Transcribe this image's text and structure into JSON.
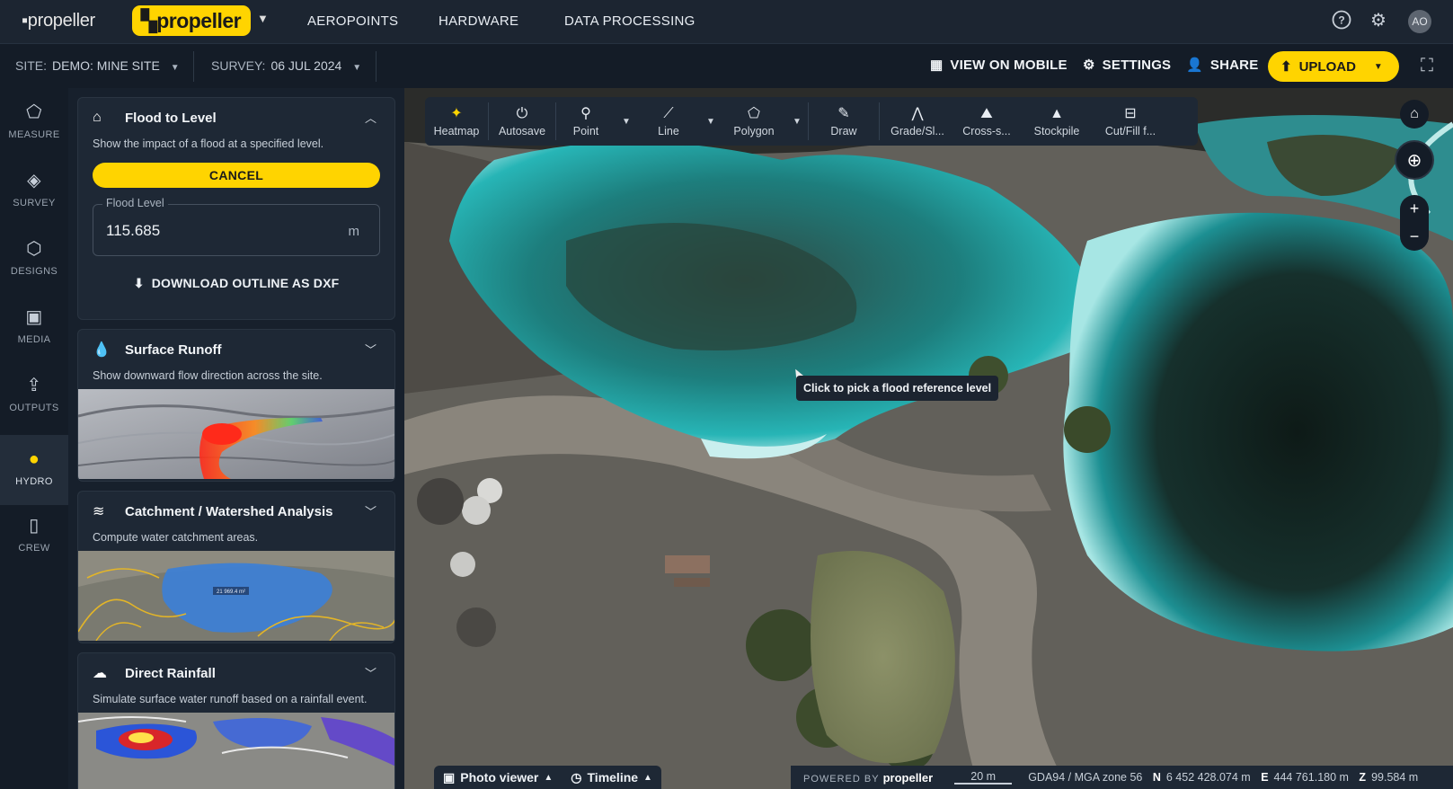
{
  "topbar": {
    "brand_small": "propeller",
    "brand_big": "propeller",
    "nav": [
      "AEROPOINTS",
      "HARDWARE",
      "DATA PROCESSING"
    ],
    "avatar": "AO"
  },
  "subbar": {
    "site_label": "SITE:",
    "site_value": "DEMO: MINE SITE",
    "survey_label": "SURVEY:",
    "survey_value": "06 JUL 2024",
    "view_mobile": "VIEW ON MOBILE",
    "settings": "SETTINGS",
    "share": "SHARE",
    "upload": "UPLOAD"
  },
  "rail": [
    {
      "label": "MEASURE",
      "icon": "pentagon-icon"
    },
    {
      "label": "SURVEY",
      "icon": "layers-icon"
    },
    {
      "label": "DESIGNS",
      "icon": "cube-icon"
    },
    {
      "label": "MEDIA",
      "icon": "image-message-icon"
    },
    {
      "label": "OUTPUTS",
      "icon": "export-icon"
    },
    {
      "label": "HYDRO",
      "icon": "droplet-icon",
      "active": true
    },
    {
      "label": "CREW",
      "icon": "phone-signal-icon"
    }
  ],
  "flood": {
    "title": "Flood to Level",
    "desc": "Show the impact of a flood at a specified level.",
    "cancel": "CANCEL",
    "field_label": "Flood Level",
    "field_value": "115.685",
    "field_unit": "m",
    "download": "DOWNLOAD OUTLINE AS DXF"
  },
  "runoff": {
    "title": "Surface Runoff",
    "desc": "Show downward flow direction across the site."
  },
  "catchment": {
    "title": "Catchment / Watershed Analysis",
    "desc": "Compute water catchment areas.",
    "thumb_label": "21 969.4 m²"
  },
  "rainfall": {
    "title": "Direct Rainfall",
    "desc": "Simulate surface water runoff based on a rainfall event."
  },
  "toolbar": {
    "heatmap": "Heatmap",
    "autosave": "Autosave",
    "point": "Point",
    "line": "Line",
    "polygon": "Polygon",
    "draw": "Draw",
    "grade": "Grade/Sl...",
    "cross": "Cross-s...",
    "stockpile": "Stockpile",
    "cutfill": "Cut/Fill f..."
  },
  "map": {
    "tooltip": "Click to pick a flood reference level"
  },
  "bottom": {
    "photo_viewer": "Photo viewer",
    "timeline": "Timeline",
    "powered_by": "POWERED BY",
    "powered_brand": "propeller",
    "scale": "20 m",
    "crs": "GDA94 / MGA zone 56",
    "n_label": "N",
    "n_value": "6 452 428.074 m",
    "e_label": "E",
    "e_value": "444 761.180 m",
    "z_label": "Z",
    "z_value": "99.584 m"
  },
  "colors": {
    "accent": "#ffd400",
    "topbar": "#1c2531",
    "panel": "#17202c",
    "water": "#1aa3a8"
  }
}
